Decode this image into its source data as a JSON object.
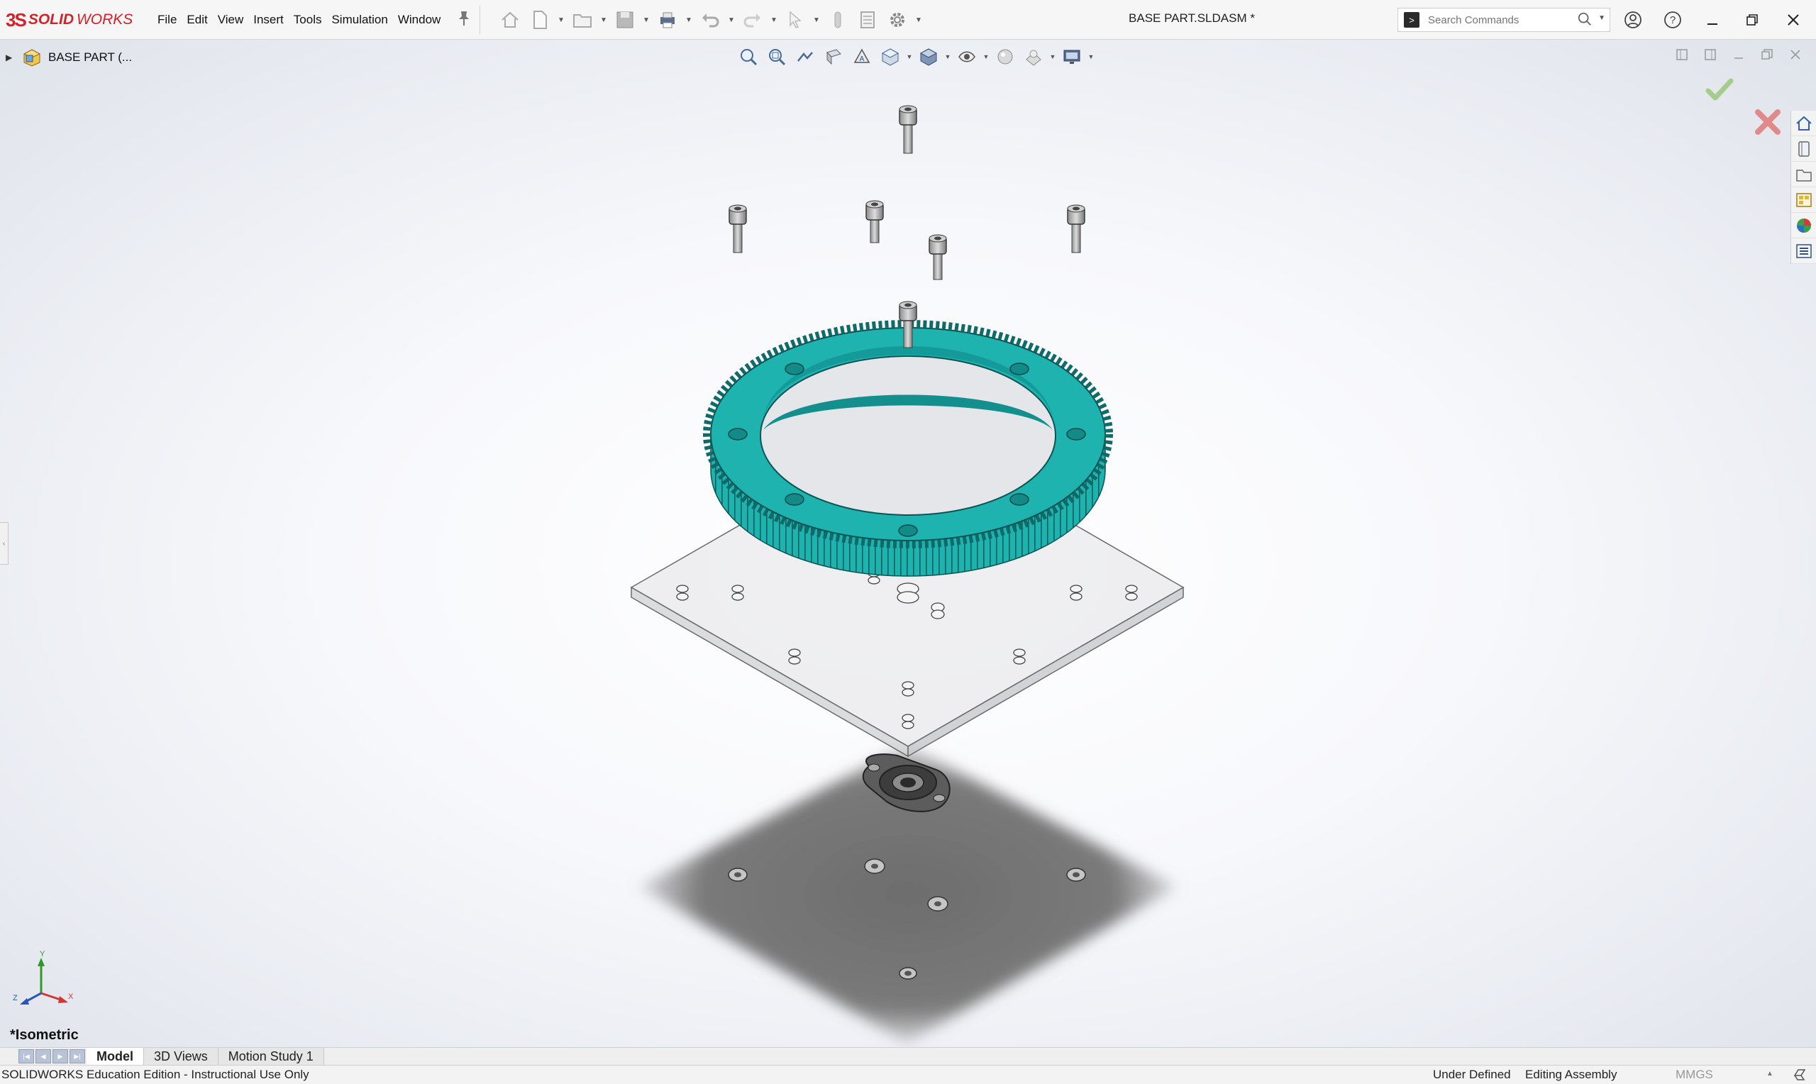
{
  "app": {
    "brand_prefix": "3S",
    "brand_bold": "SOLID",
    "brand_light": "WORKS",
    "document_title": "BASE PART.SLDASM *"
  },
  "menu": {
    "items": [
      "File",
      "Edit",
      "View",
      "Insert",
      "Tools",
      "Simulation",
      "Window"
    ]
  },
  "search": {
    "placeholder": "Search Commands"
  },
  "tree": {
    "root_label": "BASE PART  (..."
  },
  "view": {
    "orientation": "*Isometric",
    "triad_labels": {
      "x": "X",
      "y": "Y",
      "z": "Z"
    }
  },
  "tabs": [
    {
      "label": "Model",
      "active": true
    },
    {
      "label": "3D Views",
      "active": false
    },
    {
      "label": "Motion Study 1",
      "active": false
    }
  ],
  "status": {
    "edition": "SOLIDWORKS Education Edition - Instructional Use Only",
    "definition": "Under Defined",
    "mode": "Editing Assembly",
    "units": "MMGS"
  },
  "colors": {
    "gear": "#1fb3b0",
    "gear_dark": "#138a88",
    "brand": "#d2232a",
    "confirm_green": "#7bc043",
    "cancel_red": "#d9534f"
  },
  "icons": {
    "qa_toolbar": [
      "home-icon",
      "new-document-icon",
      "open-icon",
      "save-icon",
      "print-icon",
      "undo-icon",
      "redo-icon",
      "select-icon",
      "rebuild-icon",
      "file-properties-icon",
      "options-icon"
    ],
    "heads_up": [
      "zoom-to-fit-icon",
      "zoom-to-area-icon",
      "previous-view-icon",
      "section-view-icon",
      "dynamic-annotation-icon",
      "view-orientation-icon",
      "display-style-icon",
      "hide-show-items-icon",
      "edit-appearance-icon",
      "apply-scene-icon",
      "view-settings-icon"
    ],
    "task_pane": [
      "solidworks-resources-icon",
      "design-library-icon",
      "file-explorer-icon",
      "view-palette-icon",
      "appearances-icon",
      "custom-properties-icon"
    ]
  }
}
